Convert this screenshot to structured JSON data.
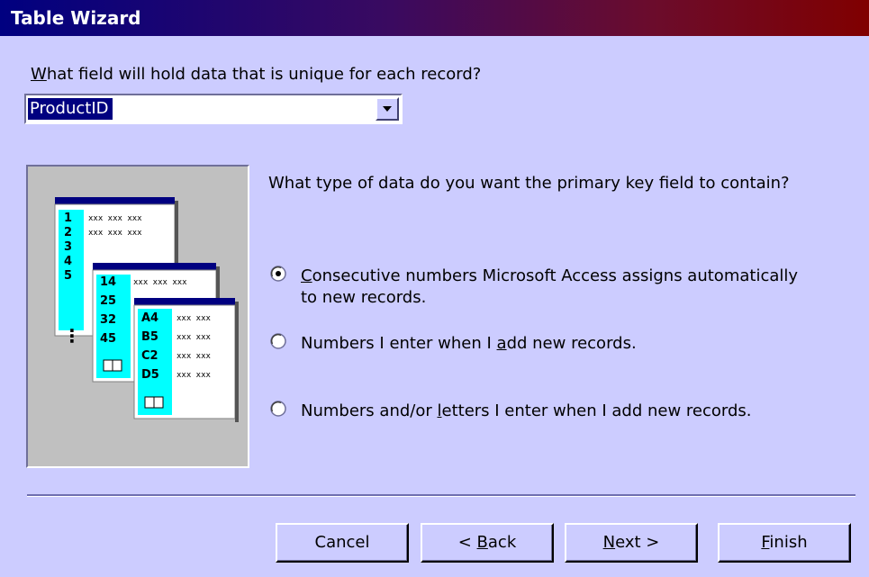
{
  "window": {
    "title": "Table Wizard"
  },
  "question": {
    "prefix": "",
    "mnemonic": "W",
    "rest": "hat field will hold data that is unique for each record?"
  },
  "field_select": {
    "value": "ProductID"
  },
  "illustration": {
    "col1": [
      "1",
      "2",
      "3",
      "4",
      "5"
    ],
    "col2": [
      "14",
      "25",
      "32",
      "45"
    ],
    "col3": [
      "A4",
      "B5",
      "C2",
      "D5"
    ],
    "placeholder": "xxx xxx xxx",
    "placeholder_short": "xxx xxx"
  },
  "prompt": "What type of data do you want the primary key field to contain?",
  "options": [
    {
      "prefix": "",
      "mnemonic": "C",
      "rest": "onsecutive numbers Microsoft Access assigns automatically",
      "line2": "to new records.",
      "selected": true
    },
    {
      "prefix": "Numbers I enter when I ",
      "mnemonic": "a",
      "rest": "dd new records.",
      "line2": "",
      "selected": false
    },
    {
      "prefix": "Numbers and/or ",
      "mnemonic": "l",
      "rest": "etters I enter when I add new records.",
      "line2": "",
      "selected": false
    }
  ],
  "buttons": {
    "cancel": "Cancel",
    "back": {
      "prefix": "< ",
      "mnemonic": "B",
      "rest": "ack"
    },
    "next": {
      "prefix": "",
      "mnemonic": "N",
      "rest": "ext >"
    },
    "finish": {
      "prefix": "",
      "mnemonic": "F",
      "rest": "inish"
    }
  },
  "colors": {
    "background": "#ccccff",
    "title_start": "#000080",
    "title_end": "#800000",
    "selection": "#000080",
    "cyan": "#00ffff"
  }
}
